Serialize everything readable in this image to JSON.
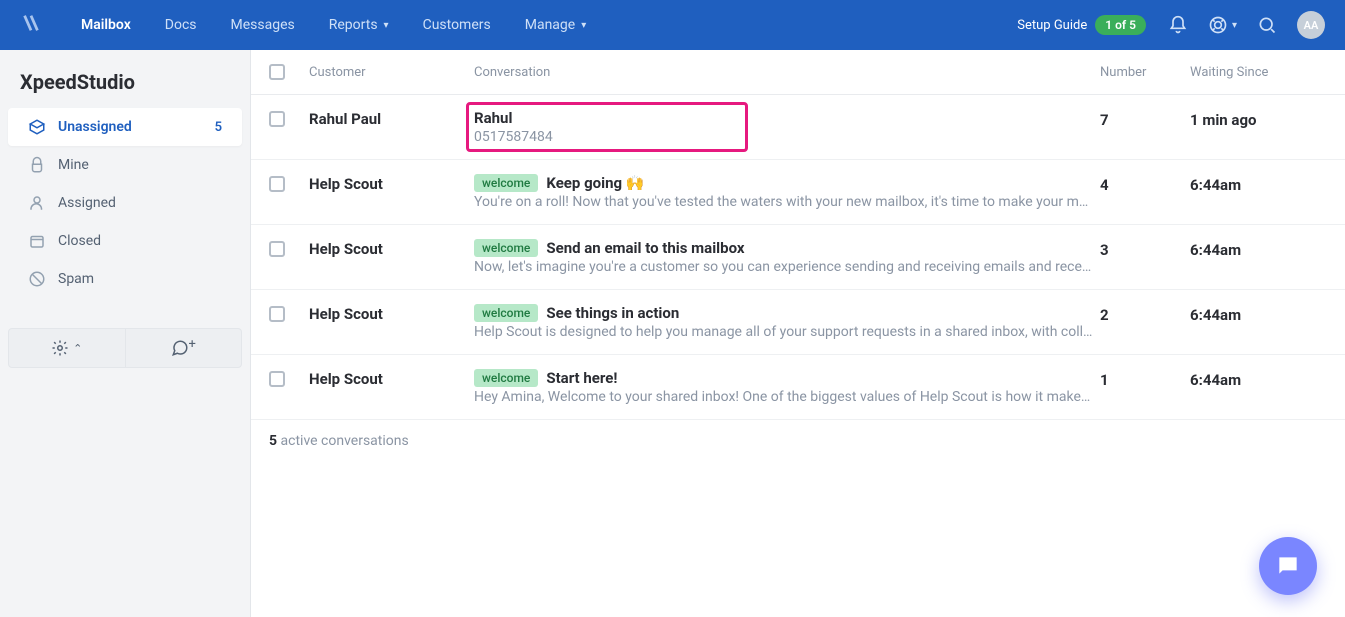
{
  "nav": {
    "items": [
      {
        "label": "Mailbox",
        "active": true,
        "chev": false
      },
      {
        "label": "Docs",
        "active": false,
        "chev": false
      },
      {
        "label": "Messages",
        "active": false,
        "chev": false
      },
      {
        "label": "Reports",
        "active": false,
        "chev": true
      },
      {
        "label": "Customers",
        "active": false,
        "chev": false
      },
      {
        "label": "Manage",
        "active": false,
        "chev": true
      }
    ],
    "setup_label": "Setup Guide",
    "setup_progress": "1 of 5",
    "avatar_initials": "AA"
  },
  "sidebar": {
    "brand": "XpeedStudio",
    "folders": [
      {
        "label": "Unassigned",
        "count": "5",
        "active": true
      },
      {
        "label": "Mine",
        "count": "",
        "active": false
      },
      {
        "label": "Assigned",
        "count": "",
        "active": false
      },
      {
        "label": "Closed",
        "count": "",
        "active": false
      },
      {
        "label": "Spam",
        "count": "",
        "active": false
      }
    ]
  },
  "table": {
    "headers": {
      "customer": "Customer",
      "conversation": "Conversation",
      "number": "Number",
      "waiting": "Waiting Since"
    },
    "rows": [
      {
        "customer": "Rahul Paul",
        "tag": "",
        "subject": "Rahul",
        "preview": "0517587484",
        "number": "7",
        "waiting": "1 min ago",
        "highlighted": true
      },
      {
        "customer": "Help Scout",
        "tag": "welcome",
        "subject": "Keep going 🙌",
        "preview": "You're on a roll! Now that you've tested the waters with your new mailbox, it's time to make your mailbox fe",
        "number": "4",
        "waiting": "6:44am",
        "highlighted": false
      },
      {
        "customer": "Help Scout",
        "tag": "welcome",
        "subject": "Send an email to this mailbox",
        "preview": "Now, let's imagine you're a customer so you can experience sending and receiving emails and receiving e",
        "number": "3",
        "waiting": "6:44am",
        "highlighted": false
      },
      {
        "customer": "Help Scout",
        "tag": "welcome",
        "subject": "See things in action",
        "preview": "Help Scout is designed to help you manage all of your support requests in a shared inbox, with collaborat",
        "number": "2",
        "waiting": "6:44am",
        "highlighted": false
      },
      {
        "customer": "Help Scout",
        "tag": "welcome",
        "subject": "Start here!",
        "preview": "Hey Amina, Welcome to your shared inbox! One of the biggest values of Help Scout is how it makes team",
        "number": "1",
        "waiting": "6:44am",
        "highlighted": false
      }
    ],
    "footer_count": "5",
    "footer_label": " active conversations"
  }
}
